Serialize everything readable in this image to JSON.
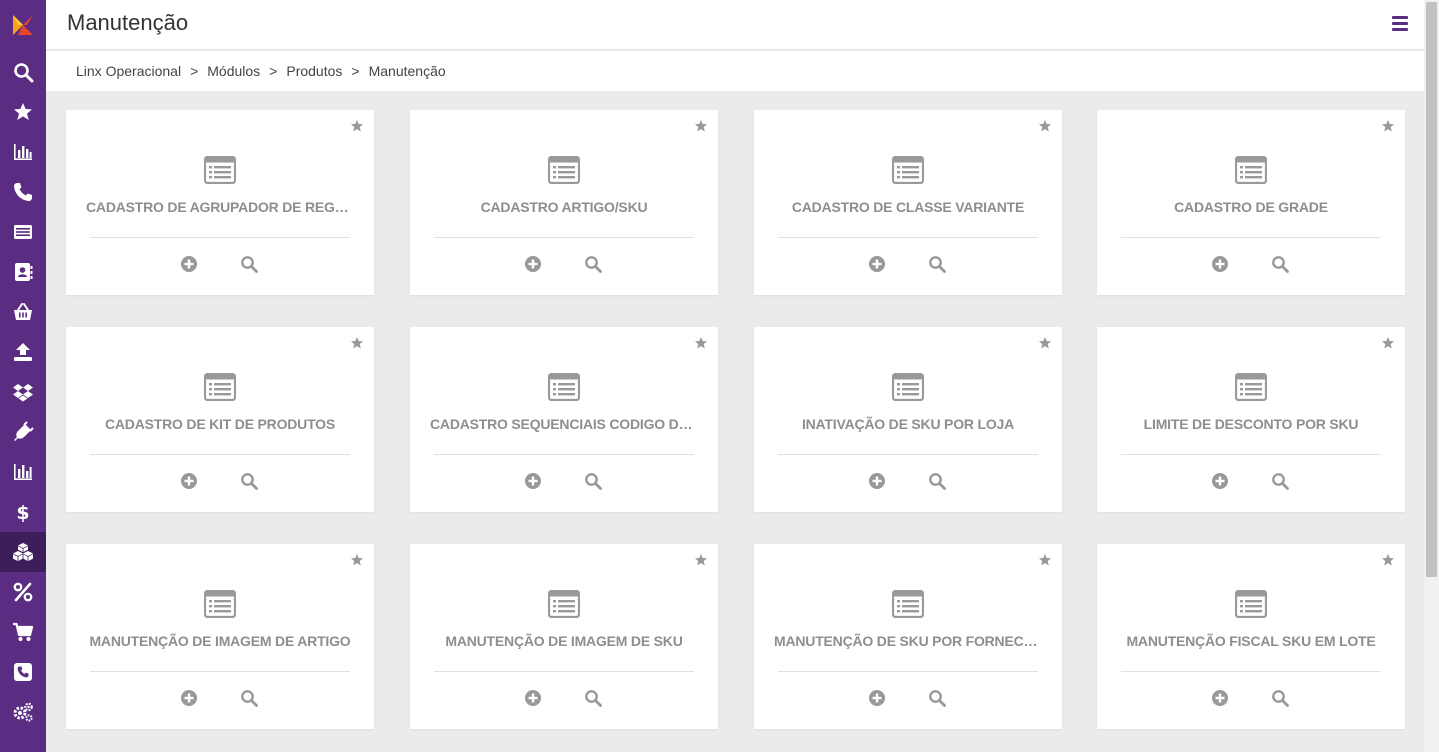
{
  "header": {
    "title": "Manutenção"
  },
  "breadcrumb": [
    {
      "label": "Linx Operacional"
    },
    {
      "label": "Módulos"
    },
    {
      "label": "Produtos"
    },
    {
      "label": "Manutenção"
    }
  ],
  "breadcrumb_separator": ">",
  "sidebar": {
    "items": [
      {
        "icon": "search-icon"
      },
      {
        "icon": "star-icon"
      },
      {
        "icon": "bar-chart-icon"
      },
      {
        "icon": "phone-icon"
      },
      {
        "icon": "list-icon"
      },
      {
        "icon": "contacts-icon"
      },
      {
        "icon": "basket-icon"
      },
      {
        "icon": "upload-icon"
      },
      {
        "icon": "dropbox-icon"
      },
      {
        "icon": "plug-icon"
      },
      {
        "icon": "report-chart-icon"
      },
      {
        "icon": "dollar-icon"
      },
      {
        "icon": "cubes-icon",
        "active": true
      },
      {
        "icon": "percent-icon"
      },
      {
        "icon": "cart-icon"
      },
      {
        "icon": "phone-square-icon"
      },
      {
        "icon": "cogs-icon"
      }
    ]
  },
  "cards": [
    {
      "title": "CADASTRO DE AGRUPADOR DE REGRAS DE ..."
    },
    {
      "title": "CADASTRO ARTIGO/SKU"
    },
    {
      "title": "CADASTRO DE CLASSE VARIANTE"
    },
    {
      "title": "CADASTRO DE GRADE"
    },
    {
      "title": "CADASTRO DE KIT DE PRODUTOS"
    },
    {
      "title": "CADASTRO SEQUENCIAIS CODIGO DE BARRA"
    },
    {
      "title": "INATIVAÇÃO DE SKU POR LOJA"
    },
    {
      "title": "LIMITE DE DESCONTO POR SKU"
    },
    {
      "title": "MANUTENÇÃO DE IMAGEM DE ARTIGO"
    },
    {
      "title": "MANUTENÇÃO DE IMAGEM DE SKU"
    },
    {
      "title": "MANUTENÇÃO DE SKU POR FORNECEDOR"
    },
    {
      "title": "MANUTENÇÃO FISCAL SKU EM LOTE"
    }
  ],
  "colors": {
    "sidebar": "#5b2d82",
    "sidebar_active": "#3d1e5a",
    "card_text": "#8e8e8e",
    "accent": "#5b2d82"
  }
}
